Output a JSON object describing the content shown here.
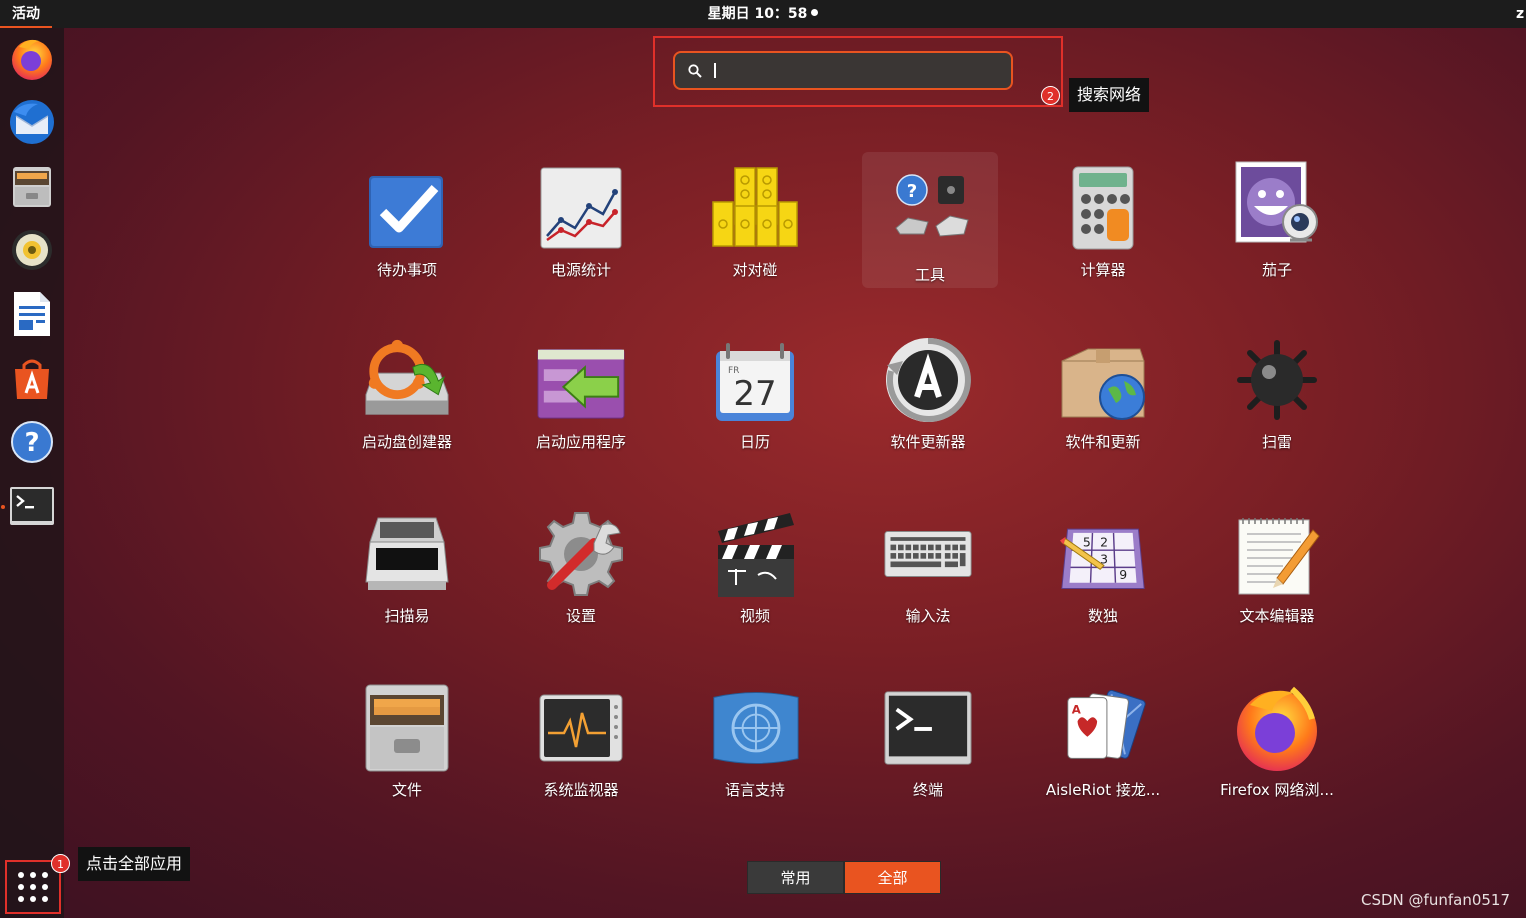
{
  "topbar": {
    "activities_label": "活动",
    "clock": "星期日 10：58",
    "user_initial": "z"
  },
  "search": {
    "placeholder": ""
  },
  "annotations": {
    "marker1": "1",
    "marker2": "2",
    "show_apps_note": "点击全部应用",
    "search_note": "搜索网络"
  },
  "apps": [
    {
      "label": "待办事项"
    },
    {
      "label": "电源统计"
    },
    {
      "label": "对对碰"
    },
    {
      "label": "工具"
    },
    {
      "label": "计算器"
    },
    {
      "label": "茄子"
    },
    {
      "label": "启动盘创建器"
    },
    {
      "label": "启动应用程序"
    },
    {
      "label": "日历",
      "day_abbr": "FR",
      "day_num": "27"
    },
    {
      "label": "软件更新器"
    },
    {
      "label": "软件和更新"
    },
    {
      "label": "扫雷"
    },
    {
      "label": "扫描易"
    },
    {
      "label": "设置"
    },
    {
      "label": "视频"
    },
    {
      "label": "输入法"
    },
    {
      "label": "数独"
    },
    {
      "label": "文本编辑器"
    },
    {
      "label": "文件"
    },
    {
      "label": "系统监视器"
    },
    {
      "label": "语言支持"
    },
    {
      "label": "终端"
    },
    {
      "label": "AisleRiot 接龙..."
    },
    {
      "label": "Firefox 网络浏..."
    }
  ],
  "dock": [
    {
      "name": "firefox"
    },
    {
      "name": "thunderbird"
    },
    {
      "name": "files"
    },
    {
      "name": "rhythmbox"
    },
    {
      "name": "libreoffice-writer"
    },
    {
      "name": "ubuntu-software"
    },
    {
      "name": "help"
    },
    {
      "name": "terminal"
    }
  ],
  "view_toggle": {
    "frequent_label": "常用",
    "all_label": "全部"
  },
  "watermark": "CSDN @funfan0517",
  "colors": {
    "accent": "#e95420",
    "highlight_red": "#e0302a",
    "topbar": "#1c1c1c"
  }
}
